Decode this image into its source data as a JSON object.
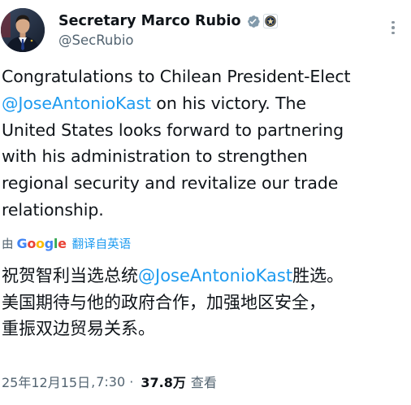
{
  "author": {
    "display_name": "Secretary Marco Rubio",
    "handle": "@SecRubio",
    "avatar_icon": "person-portrait-avatar",
    "verified_icon": "verified-gray-badge-icon",
    "affiliation_icon": "department-of-state-seal-icon"
  },
  "tweet": {
    "lines": [
      {
        "before": "Congratulations to Chilean President-Elect",
        "mention": "",
        "after": ""
      },
      {
        "before": "",
        "mention": "@JoseAntonioKast",
        "after": " on his victory. The"
      },
      {
        "before": "United States looks forward to partnering",
        "mention": "",
        "after": ""
      },
      {
        "before": "with his administration to strengthen",
        "mention": "",
        "after": ""
      },
      {
        "before": "regional security and revitalize our trade",
        "mention": "",
        "after": ""
      },
      {
        "before": "relationship.",
        "mention": "",
        "after": ""
      }
    ]
  },
  "translation": {
    "by_label": "由",
    "provider_letters": [
      "G",
      "o",
      "o",
      "g",
      "l",
      "e"
    ],
    "translated_from_label": "翻译自英语",
    "lines": [
      {
        "before": "祝贺智利当选总统",
        "mention": "@JoseAntonioKast",
        "after": "胜选。"
      },
      {
        "before": "美国期待与他的政府合作，加强地区安全，",
        "mention": "",
        "after": ""
      },
      {
        "before": "重振双边贸易关系。",
        "mention": "",
        "after": ""
      }
    ]
  },
  "meta": {
    "date": "25年12月15日",
    "separator": ",",
    "time": " 7:30",
    "dot": " · ",
    "views_count": "37.8万",
    "views_label": "查看"
  },
  "colors": {
    "text_primary": "#0f1419",
    "text_secondary": "#536471",
    "link": "#1d9bf0",
    "google_blue": "#4285f4",
    "google_red": "#ea4335",
    "google_yellow": "#fbbc05",
    "google_green": "#34a853"
  }
}
